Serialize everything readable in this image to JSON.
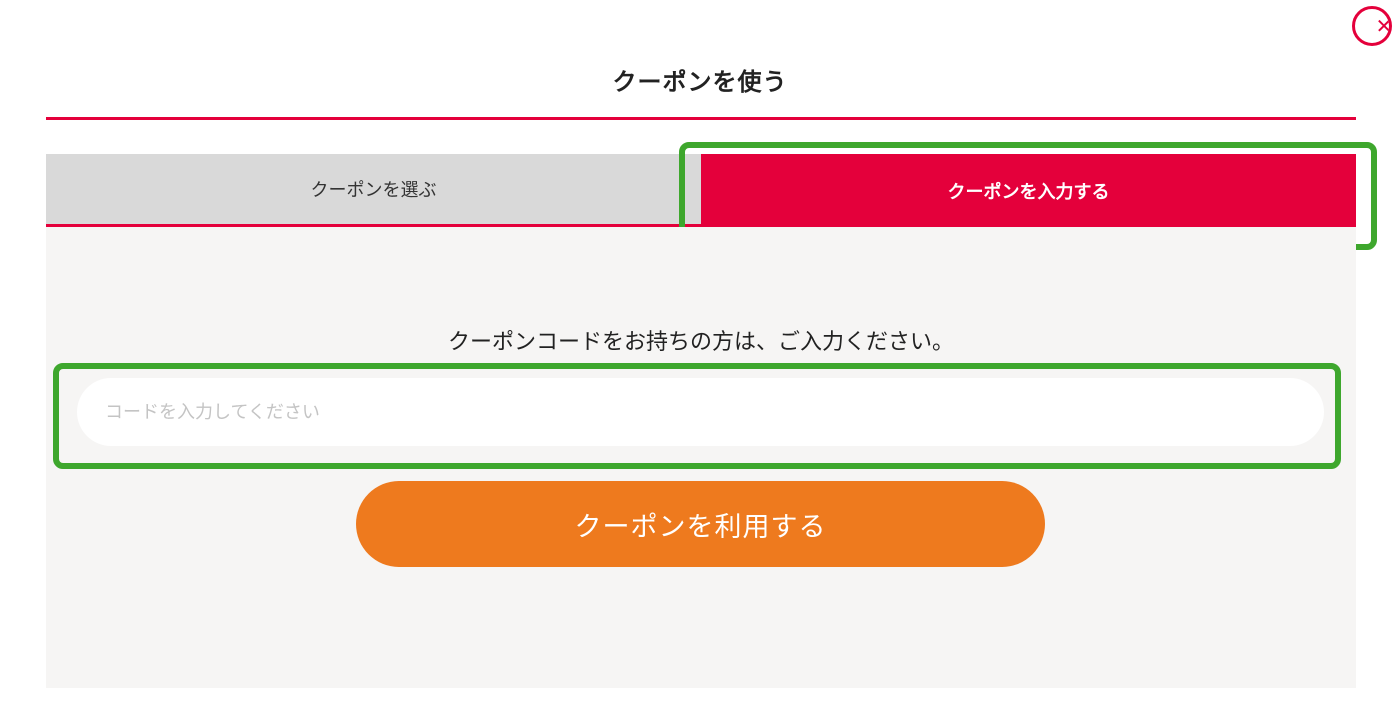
{
  "dialog": {
    "close_icon": "close-icon",
    "close_glyph": "✕",
    "title": "クーポンを使う"
  },
  "tabs": [
    {
      "label": "クーポンを選ぶ",
      "active": false
    },
    {
      "label": "クーポンを入力する",
      "active": true
    }
  ],
  "panel": {
    "description": "クーポンコードをお持ちの方は、ご入力ください。",
    "input": {
      "value": "",
      "placeholder": "コードを入力してください"
    },
    "submit_label": "クーポンを利用する"
  },
  "colors": {
    "accent": "#e4003b",
    "button": "#ee7a1e",
    "highlight": "#3ea72d",
    "inactive_tab": "#d9d9d9",
    "panel_bg": "#f6f5f4"
  }
}
